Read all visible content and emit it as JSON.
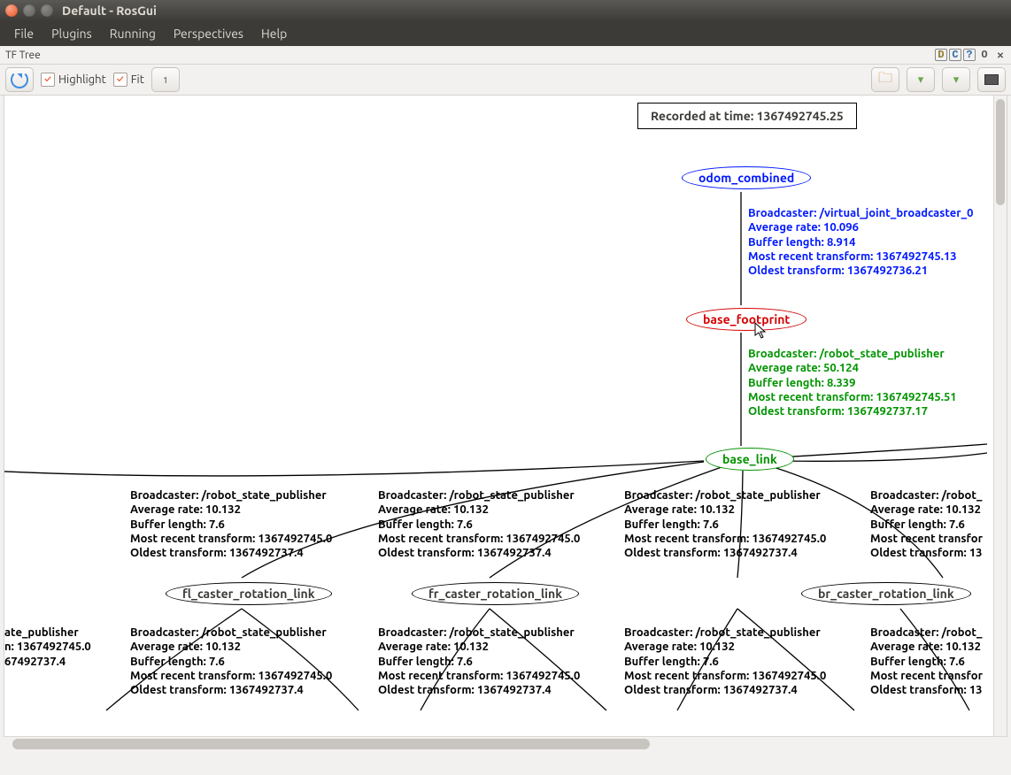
{
  "window": {
    "title": "Default - RosGui"
  },
  "menu": {
    "file": "File",
    "plugins": "Plugins",
    "running": "Running",
    "perspectives": "Perspectives",
    "help": "Help"
  },
  "dock": {
    "tf_tree": "TF Tree",
    "d": "D",
    "c": "C",
    "help": "?",
    "detach": "O",
    "close": "✕"
  },
  "toolbar": {
    "highlight_label": "Highlight",
    "fit_label": "Fit",
    "checkbox_mark": "✓",
    "level_label": "1"
  },
  "graph": {
    "recorded_label": "Recorded at time: 1367492745.25",
    "nodes": {
      "odom_combined": "odom_combined",
      "base_footprint": "base_footprint",
      "base_link": "base_link",
      "fl_caster": "fl_caster_rotation_link",
      "fr_caster": "fr_caster_rotation_link",
      "br_caster": "br_caster_rotation_link"
    },
    "edge_odom": {
      "l1": "Broadcaster: /virtual_joint_broadcaster_0",
      "l2": "Average rate: 10.096",
      "l3": "Buffer length: 8.914",
      "l4": "Most recent transform: 1367492745.13",
      "l5": "Oldest transform: 1367492736.21"
    },
    "edge_footprint": {
      "l1": "Broadcaster: /robot_state_publisher",
      "l2": "Average rate: 50.124",
      "l3": "Buffer length: 8.339",
      "l4": "Most recent transform: 1367492745.51",
      "l5": "Oldest transform: 1367492737.17"
    },
    "edge_caster_a": {
      "l1": "Broadcaster: /robot_state_publisher",
      "l2": "Average rate: 10.132",
      "l3": "Buffer length: 7.6",
      "l4": "Most recent transform: 1367492745.0",
      "l5": "Oldest transform: 1367492737.4"
    },
    "edge_caster_cut_left": {
      "l1": "ate_publisher",
      "l2": "",
      "l3": "",
      "l4": "n: 1367492745.0",
      "l5": "67492737.4"
    },
    "edge_caster_cut_right": {
      "l1": "Broadcaster: /robot_",
      "l2": "Average rate: 10.132",
      "l3": "Buffer length: 7.6",
      "l4": "Most recent transfor",
      "l5": "Oldest transform: 13"
    },
    "edge_lower_cut_right": {
      "l1": "Broadcaster: /robot_",
      "l2": "Average rate: 10.132",
      "l3": "Buffer length: 7.6",
      "l4": "Most recent transfor",
      "l5": "Oldest transform: 13"
    }
  }
}
